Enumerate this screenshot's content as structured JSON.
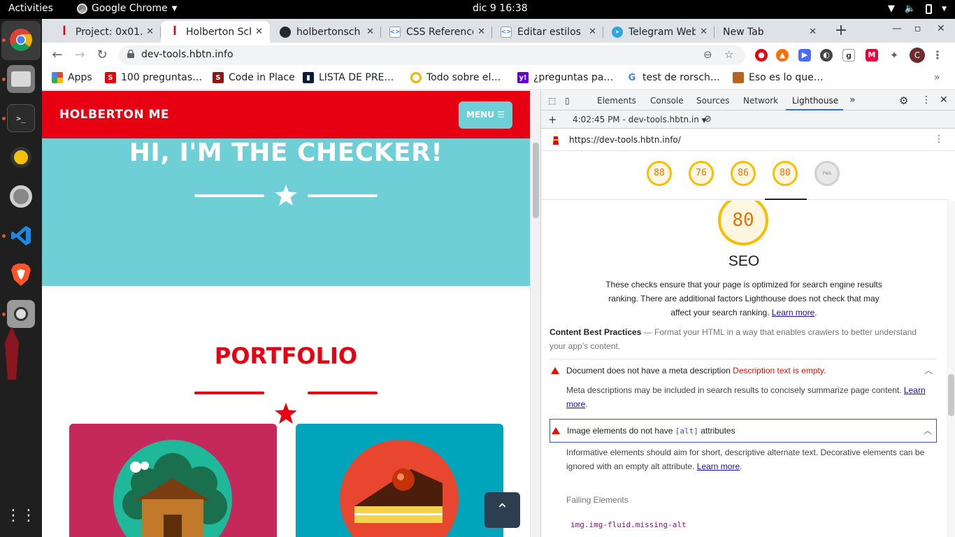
{
  "os": {
    "activities": "Activities",
    "app_name": "Google Chrome",
    "clock": "dic 9  16:38"
  },
  "tabs": [
    {
      "title": "Project: 0x01.",
      "favicon": "holberton-icon"
    },
    {
      "title": "Holberton Sch",
      "favicon": "holberton-icon",
      "active": true
    },
    {
      "title": "holbertonsch",
      "favicon": "github-icon"
    },
    {
      "title": "CSS Reference",
      "favicon": "css-icon"
    },
    {
      "title": "Editar estilos",
      "favicon": "css-icon"
    },
    {
      "title": "Telegram Web",
      "favicon": "telegram-icon"
    },
    {
      "title": "New Tab",
      "favicon": ""
    }
  ],
  "address_bar": {
    "url": "dev-tools.hbtn.info"
  },
  "bookmarks": [
    {
      "label": "Apps",
      "icon": "apps-grid-icon"
    },
    {
      "label": "100 preguntas…",
      "icon": "bookmark-icon"
    },
    {
      "label": "Code in Place",
      "icon": "stanford-icon"
    },
    {
      "label": "LISTA DE PRE…",
      "icon": "bookmark-icon"
    },
    {
      "label": "Todo sobre el…",
      "icon": "bookmark-icon"
    },
    {
      "label": "¿preguntas pa…",
      "icon": "yahoo-icon"
    },
    {
      "label": "test de rorsch…",
      "icon": "google-icon"
    },
    {
      "label": "Eso es lo que…",
      "icon": "bookmark-icon"
    }
  ],
  "extension_avatar": "C",
  "website": {
    "brand": "HOLBERTON ME",
    "menu_label": "MENU",
    "hero_title": "HI, I'M THE CHECKER!",
    "portfolio_title": "PORTFOLIO",
    "colors": {
      "primary": "#e60012",
      "hero": "#6fcfd6",
      "card1": "#c5285a",
      "card2": "#00a5bb"
    }
  },
  "devtools": {
    "tabs": [
      "Elements",
      "Console",
      "Sources",
      "Network",
      "Lighthouse"
    ],
    "active_tab": "Lighthouse",
    "report_time": "4:02:45 PM - dev-tools.hbtn.in",
    "report_url": "https://dev-tools.hbtn.info/",
    "scores": [
      {
        "value": "88"
      },
      {
        "value": "76"
      },
      {
        "value": "86"
      },
      {
        "value": "80"
      },
      {
        "value": "PWA"
      }
    ],
    "seo": {
      "score": "80",
      "title": "SEO",
      "desc": "These checks ensure that your page is optimized for search engine results ranking. There are additional factors Lighthouse does not check that may affect your search ranking.",
      "learn_more": "Learn more",
      "group_title": "Content Best Practices",
      "group_desc": "Format your HTML in a way that enables crawlers to better understand your app’s content."
    },
    "audits": [
      {
        "title": "Document does not have a meta description",
        "detail": "Description text is empty.",
        "body": "Meta descriptions may be included in search results to concisely summarize page content.",
        "learn_more": "Learn more"
      },
      {
        "title_pre": "Image elements do not have",
        "title_code": "[alt]",
        "title_post": "attributes",
        "body": "Informative elements should aim for short, descriptive alternate text. Decorative elements can be ignored with an empty alt attribute.",
        "learn_more": "Learn more",
        "failing_label": "Failing Elements",
        "failing_node": "img.img-fluid.missing-alt"
      }
    ]
  }
}
